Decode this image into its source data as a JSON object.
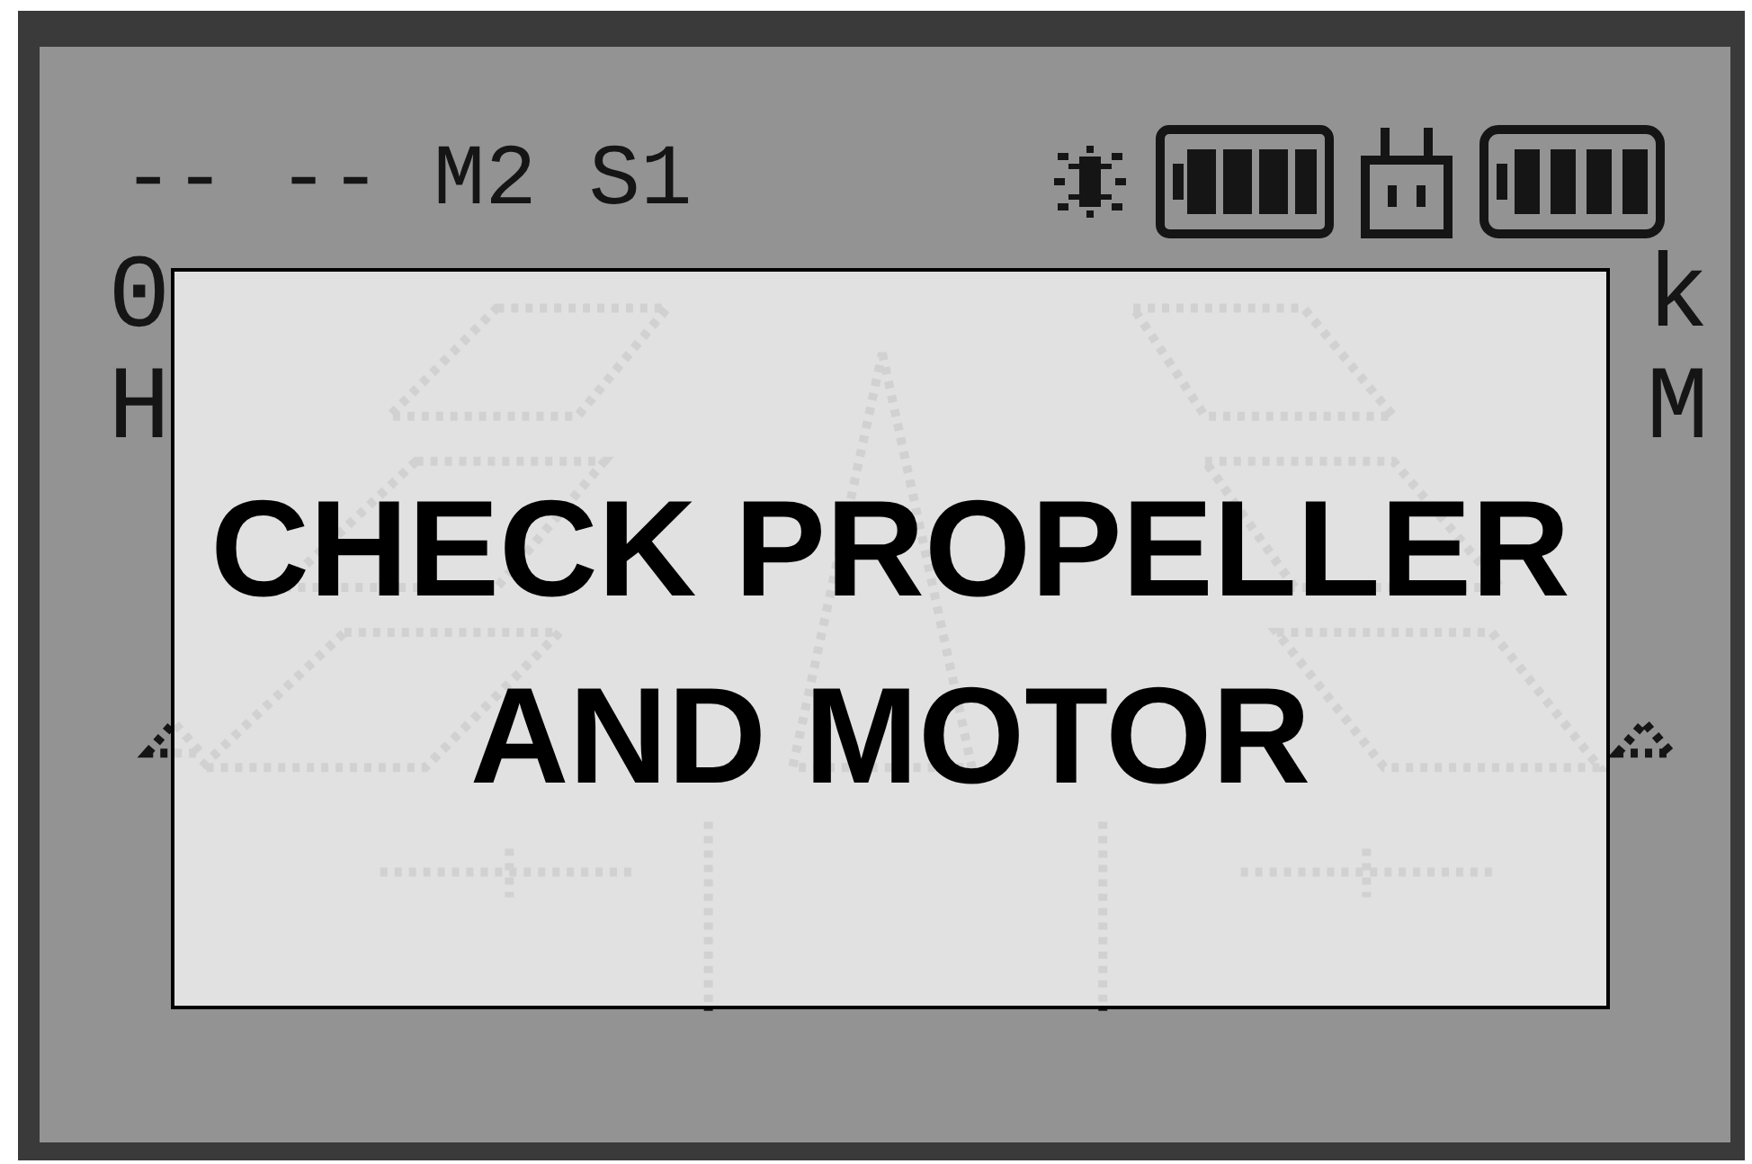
{
  "status_bar": {
    "text": "-- -- M2 S1"
  },
  "readouts": [
    {
      "value": "0",
      "label": "H"
    },
    {
      "value": "k",
      "label": "M"
    }
  ],
  "alert": {
    "lines": [
      "CHECK PROPELLER",
      "AND MOTOR"
    ]
  }
}
